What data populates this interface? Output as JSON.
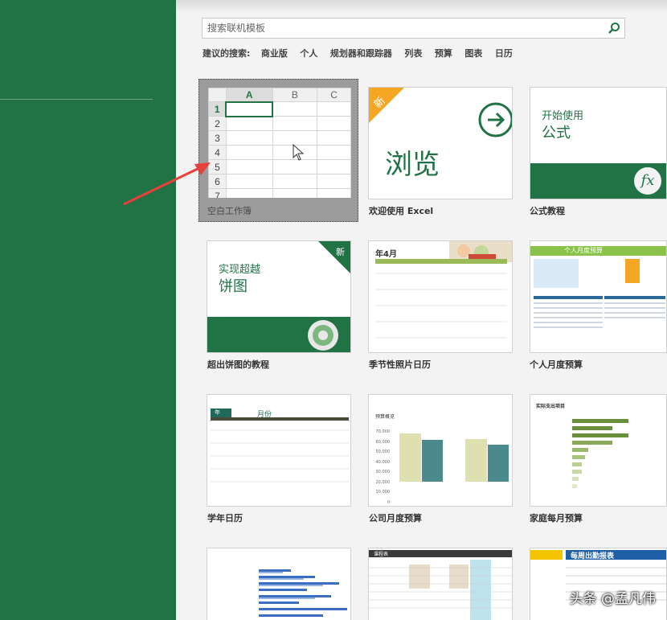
{
  "search": {
    "placeholder": "搜索联机模板"
  },
  "suggestions": {
    "label": "建议的搜索:",
    "items": [
      "商业版",
      "个人",
      "规划器和跟踪器",
      "列表",
      "预算",
      "图表",
      "日历"
    ]
  },
  "templates": [
    {
      "label": "空白工作簿"
    },
    {
      "label": "欢迎使用 Excel",
      "badge": "新",
      "big": "浏览"
    },
    {
      "label": "公式教程",
      "line1": "开始使用",
      "line2": "公式",
      "fx": "fx"
    },
    {
      "label": "超出饼图的教程",
      "line1": "实现超越",
      "line2": "饼图",
      "badge": "新"
    },
    {
      "label": "季节性照片日历",
      "month": "年4月"
    },
    {
      "label": "个人月度预算",
      "title": "个人月度预算"
    },
    {
      "label": "学年日历",
      "tab1": "年",
      "tab2": "月份"
    },
    {
      "label": "公司月度预算",
      "title": "预算概览",
      "yticks": [
        "70,000",
        "60,000",
        "50,000",
        "40,000",
        "30,000",
        "20,000",
        "10,000",
        "0"
      ]
    },
    {
      "label": "家庭每月预算",
      "title": "实际支出项目"
    },
    {
      "label": ""
    },
    {
      "label": "",
      "title": "课程表"
    },
    {
      "label": "",
      "title": "每周出勤报表"
    }
  ],
  "grid": {
    "columns": [
      "A",
      "B",
      "C"
    ],
    "rows": [
      "1",
      "2",
      "3",
      "4",
      "5",
      "6",
      "7"
    ]
  },
  "watermark": "头条 @孟凡伟",
  "colors": {
    "accent": "#217346",
    "orange": "#f5a623",
    "pane": "#217346"
  }
}
